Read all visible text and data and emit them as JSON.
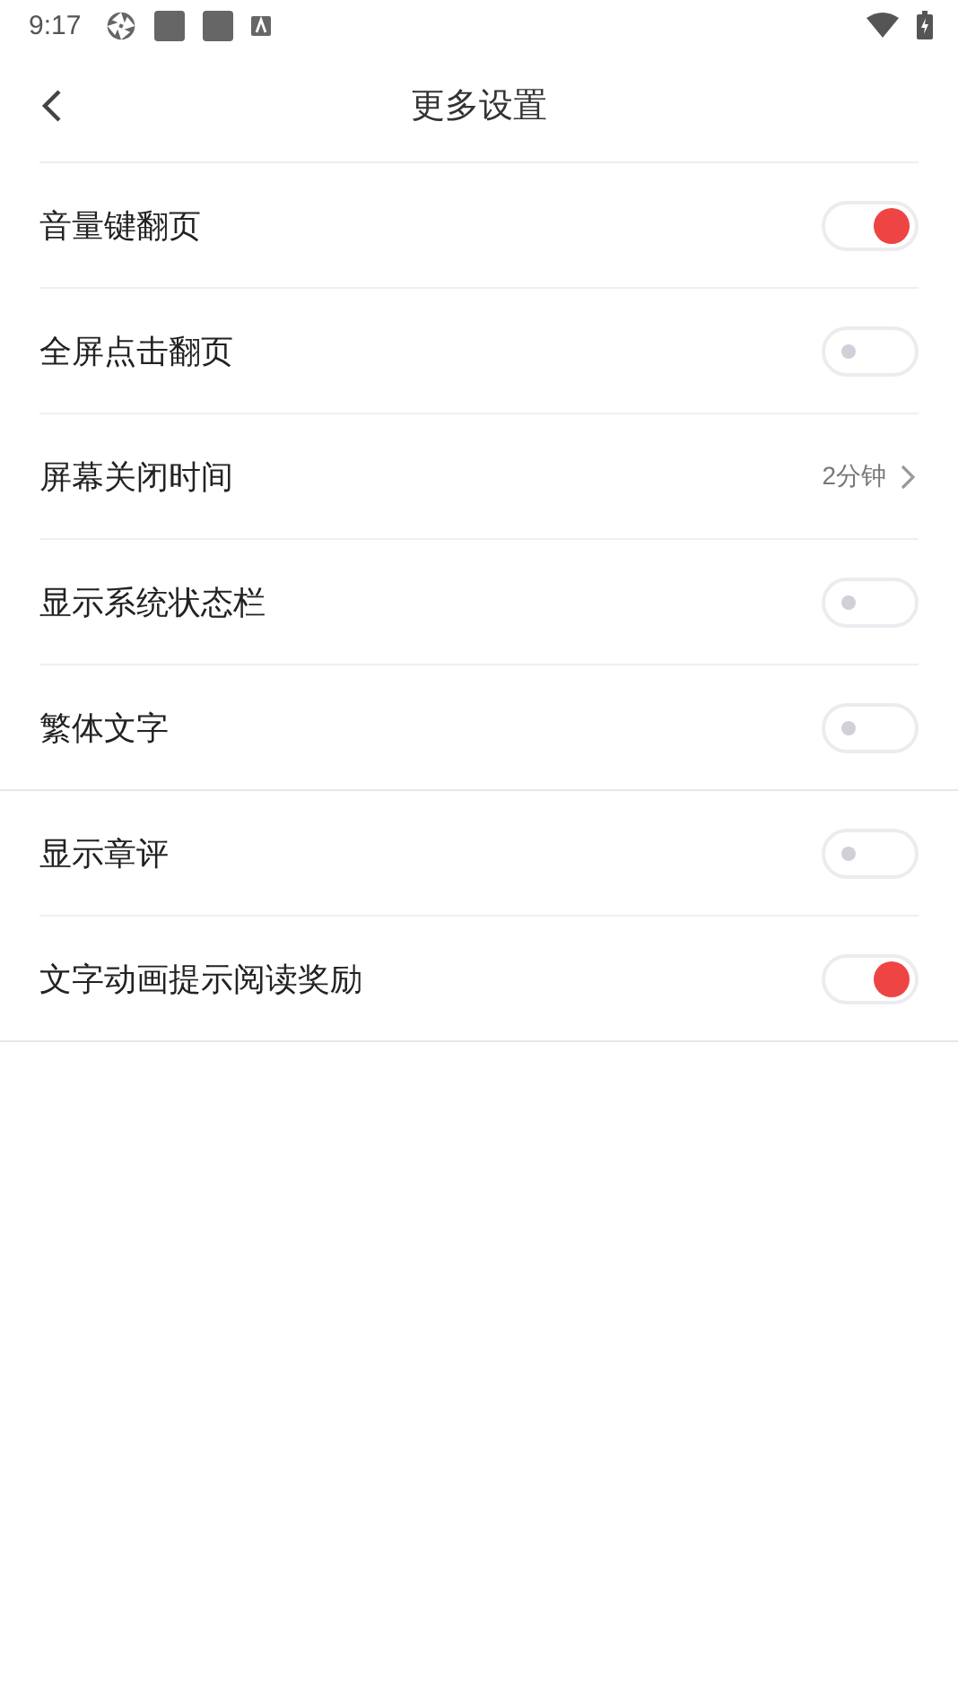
{
  "status_bar": {
    "time": "9:17"
  },
  "header": {
    "title": "更多设置"
  },
  "groups": [
    {
      "rows": [
        {
          "kind": "toggle",
          "label": "音量键翻页",
          "on": true
        },
        {
          "kind": "toggle",
          "label": "全屏点击翻页",
          "on": false
        },
        {
          "kind": "link",
          "label": "屏幕关闭时间",
          "value": "2分钟"
        },
        {
          "kind": "toggle",
          "label": "显示系统状态栏",
          "on": false
        },
        {
          "kind": "toggle",
          "label": "繁体文字",
          "on": false
        }
      ]
    },
    {
      "rows": [
        {
          "kind": "toggle",
          "label": "显示章评",
          "on": false
        },
        {
          "kind": "toggle",
          "label": "文字动画提示阅读奖励",
          "on": true
        }
      ]
    }
  ]
}
